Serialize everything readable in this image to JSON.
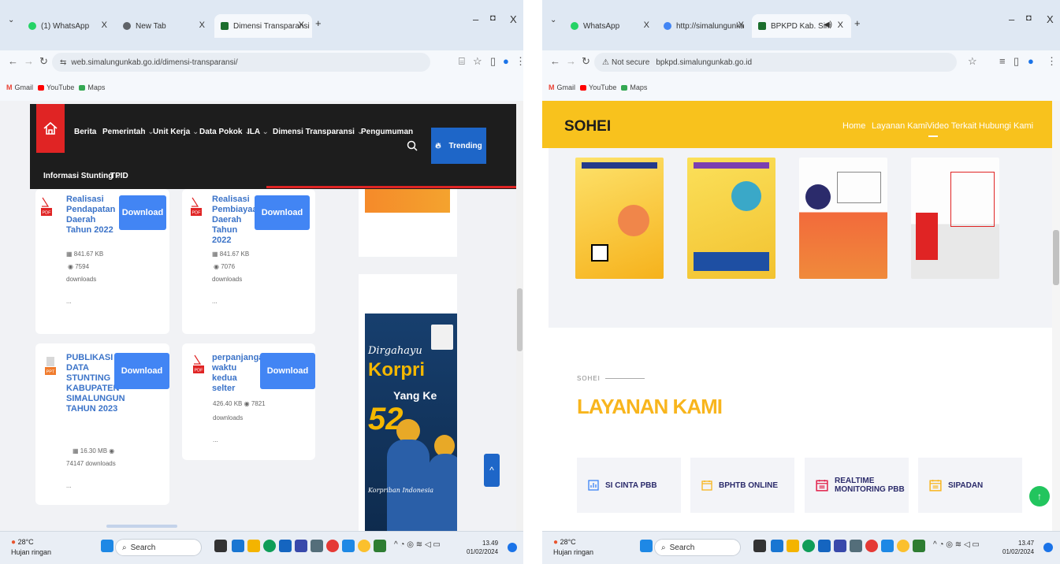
{
  "left": {
    "tabs": [
      {
        "label": "(1) WhatsApp",
        "active": false
      },
      {
        "label": "New Tab",
        "active": false
      },
      {
        "label": "Dimensi Transparansi",
        "active": true
      }
    ],
    "new_tab": "+",
    "window_controls": {
      "minimize": "–",
      "restore": "◘",
      "close": "X"
    },
    "url": "web.simalungunkab.go.id/dimensi-transparansi/",
    "bookmarks": [
      "Gmail",
      "YouTube",
      "Maps"
    ],
    "nav": {
      "items": [
        "Berita",
        "Pemerintah",
        "Unit Kerja",
        "Data Pokok",
        "ILA",
        "Dimensi Transparansi",
        "Pengumuman"
      ],
      "row2": [
        "Informasi Stunting",
        "TPID"
      ],
      "trending": "Trending"
    },
    "cards": [
      {
        "title": "Realisasi Pendapatan Daerah Tahun 2022",
        "type": "PDF",
        "button": "Download",
        "size": "841.67 KB",
        "views": "7594",
        "downloads": "downloads",
        "more": "..."
      },
      {
        "title": "Realisasi Pembiayaan Daerah Tahun 2022",
        "type": "PDF",
        "button": "Download",
        "size": "841.67 KB",
        "views": "7076",
        "downloads": "downloads",
        "more": "..."
      },
      {
        "title": "PUBLIKASI DATA STUNTING KABUPATEN SIMALUNGUN TAHUN 2023",
        "type": "PPT",
        "button": "Download",
        "size": "16.30 MB",
        "views": "",
        "downloads": "74147 downloads",
        "more": "..."
      },
      {
        "title": "perpanjangan waktu kedua selter",
        "type": "PDF",
        "button": "Download",
        "size": "426.40 KB",
        "views": "7821",
        "downloads": "downloads",
        "more": "..."
      }
    ],
    "banner": {
      "line1": "Dirgahayu",
      "line2": "Korpri",
      "line3": "Yang Ke",
      "number": "52",
      "footer": "Korpriban Indonesia"
    }
  },
  "right": {
    "tabs": [
      {
        "label": "WhatsApp",
        "active": false
      },
      {
        "label": "http://simalungunkab.go.id - G",
        "active": false
      },
      {
        "label": "BPKPD Kab. Simalungun",
        "active": true
      }
    ],
    "new_tab": "+",
    "window_controls": {
      "minimize": "–",
      "restore": "◘",
      "close": "X"
    },
    "security": "Not secure",
    "url": "bpkpd.simalungunkab.go.id",
    "bookmarks": [
      "Gmail",
      "YouTube",
      "Maps"
    ],
    "logo": "SOHEI",
    "nav": [
      "Home",
      "Layanan Kami",
      "Video Terkait",
      "Hubungi Kami"
    ],
    "section_small": "SOHEI",
    "section_title": "LAYANAN KAMI",
    "services": [
      "SI CINTA PBB",
      "BPHTB ONLINE",
      "REALTIME MONITORING PBB",
      "SIPADAN"
    ]
  },
  "taskbar": {
    "temperature": "28°C",
    "weather": "Hujan ringan",
    "search": "Search",
    "left_time": "13.49",
    "left_date": "01/02/2024",
    "right_time": "13.47",
    "right_date": "01/02/2024"
  },
  "colors": {
    "accent_red": "#e02424",
    "button_blue": "#4285f4",
    "brand_yellow": "#f8c21d",
    "service_navy": "#2b2b6b"
  }
}
